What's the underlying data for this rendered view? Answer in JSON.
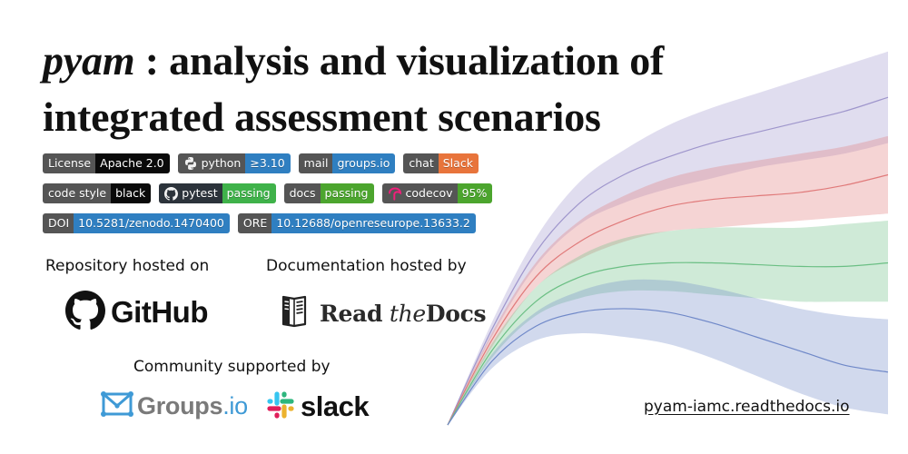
{
  "title": {
    "package": "pyam",
    "separator": " : ",
    "line1_rest": "analysis and visualization of",
    "line2": "integrated assessment scenarios"
  },
  "badges": [
    {
      "id": "license",
      "label": "License",
      "value": "Apache 2.0",
      "value_color": "#0a0a0a",
      "icon": null
    },
    {
      "id": "python",
      "label": "python",
      "value": "≥3.10",
      "value_color": "#2f7fc1",
      "icon": "python-icon"
    },
    {
      "id": "mail",
      "label": "mail",
      "value": "groups.io",
      "value_color": "#2f7fc1",
      "icon": null
    },
    {
      "id": "chat",
      "label": "chat",
      "value": "Slack",
      "value_color": "#e8743b",
      "icon": null
    },
    {
      "id": "code-style",
      "label": "code style",
      "value": "black",
      "value_color": "#0a0a0a",
      "icon": null
    },
    {
      "id": "pytest",
      "label": "pytest",
      "value": "passing",
      "value_color": "#3fb24a",
      "icon": "github-icon"
    },
    {
      "id": "docs",
      "label": "docs",
      "value": "passing",
      "value_color": "#4ca52e",
      "icon": null
    },
    {
      "id": "codecov",
      "label": "codecov",
      "value": "95%",
      "value_color": "#4ca52e",
      "icon": "codecov-icon"
    },
    {
      "id": "doi",
      "label": "DOI",
      "value": "10.5281/zenodo.1470400",
      "value_color": "#2f7fc1",
      "icon": null
    },
    {
      "id": "ore",
      "label": "ORE",
      "value": "10.12688/openreseurope.13633.2",
      "value_color": "#2f7fc1",
      "icon": null
    }
  ],
  "sections": {
    "repository_label": "Repository hosted on",
    "repository_logo": "GitHub",
    "docs_label": "Documentation hosted by",
    "docs_logo": {
      "read": "Read",
      "the": "the",
      "docs": "Docs"
    },
    "community_label": "Community supported by",
    "groups_logo": {
      "name": "Groups",
      "suffix": ".io"
    },
    "slack_logo": "slack"
  },
  "url": "pyam-iamc.readthedocs.io",
  "colors": {
    "badge_label": "#555555",
    "badge_label_dark": "#2c333b",
    "bands": [
      "#9f96cc",
      "#e07a7a",
      "#6bbf84",
      "#6f88c8"
    ]
  },
  "chart_data": {
    "type": "area",
    "title": "",
    "xlabel": "",
    "ylabel": "",
    "grid": false,
    "axes_visible": false,
    "x": [
      0,
      0.1,
      0.2,
      0.3,
      0.4,
      0.5,
      0.6,
      0.7,
      0.8,
      0.9,
      1.0
    ],
    "xlim": [
      0,
      1
    ],
    "ylim": [
      0,
      1
    ],
    "series": [
      {
        "name": "purple",
        "color": "#9f96cc",
        "median": [
          0.0,
          0.27,
          0.49,
          0.63,
          0.71,
          0.76,
          0.8,
          0.83,
          0.86,
          0.89,
          0.93
        ],
        "lower": [
          0.0,
          0.25,
          0.45,
          0.57,
          0.63,
          0.67,
          0.7,
          0.73,
          0.75,
          0.77,
          0.8
        ],
        "upper": [
          0.0,
          0.29,
          0.53,
          0.69,
          0.78,
          0.85,
          0.9,
          0.94,
          0.98,
          1.02,
          1.06
        ]
      },
      {
        "name": "red",
        "color": "#e07a7a",
        "median": [
          0.0,
          0.24,
          0.42,
          0.52,
          0.58,
          0.62,
          0.64,
          0.65,
          0.66,
          0.68,
          0.71
        ],
        "lower": [
          0.0,
          0.22,
          0.39,
          0.47,
          0.52,
          0.55,
          0.56,
          0.57,
          0.58,
          0.59,
          0.6
        ],
        "upper": [
          0.0,
          0.26,
          0.46,
          0.58,
          0.65,
          0.7,
          0.73,
          0.75,
          0.77,
          0.79,
          0.82
        ]
      },
      {
        "name": "green",
        "color": "#6bbf84",
        "median": [
          0.0,
          0.21,
          0.35,
          0.42,
          0.45,
          0.46,
          0.46,
          0.455,
          0.45,
          0.45,
          0.46
        ],
        "lower": [
          0.0,
          0.19,
          0.31,
          0.36,
          0.38,
          0.38,
          0.37,
          0.36,
          0.35,
          0.35,
          0.35
        ],
        "upper": [
          0.0,
          0.23,
          0.39,
          0.48,
          0.53,
          0.55,
          0.56,
          0.56,
          0.56,
          0.57,
          0.58
        ]
      },
      {
        "name": "blue",
        "color": "#6f88c8",
        "median": [
          0.0,
          0.18,
          0.28,
          0.32,
          0.33,
          0.32,
          0.29,
          0.25,
          0.21,
          0.17,
          0.15
        ],
        "lower": [
          0.0,
          0.16,
          0.24,
          0.26,
          0.25,
          0.23,
          0.19,
          0.14,
          0.09,
          0.05,
          0.03
        ],
        "upper": [
          0.0,
          0.2,
          0.32,
          0.38,
          0.41,
          0.41,
          0.39,
          0.36,
          0.33,
          0.31,
          0.3
        ]
      }
    ]
  }
}
